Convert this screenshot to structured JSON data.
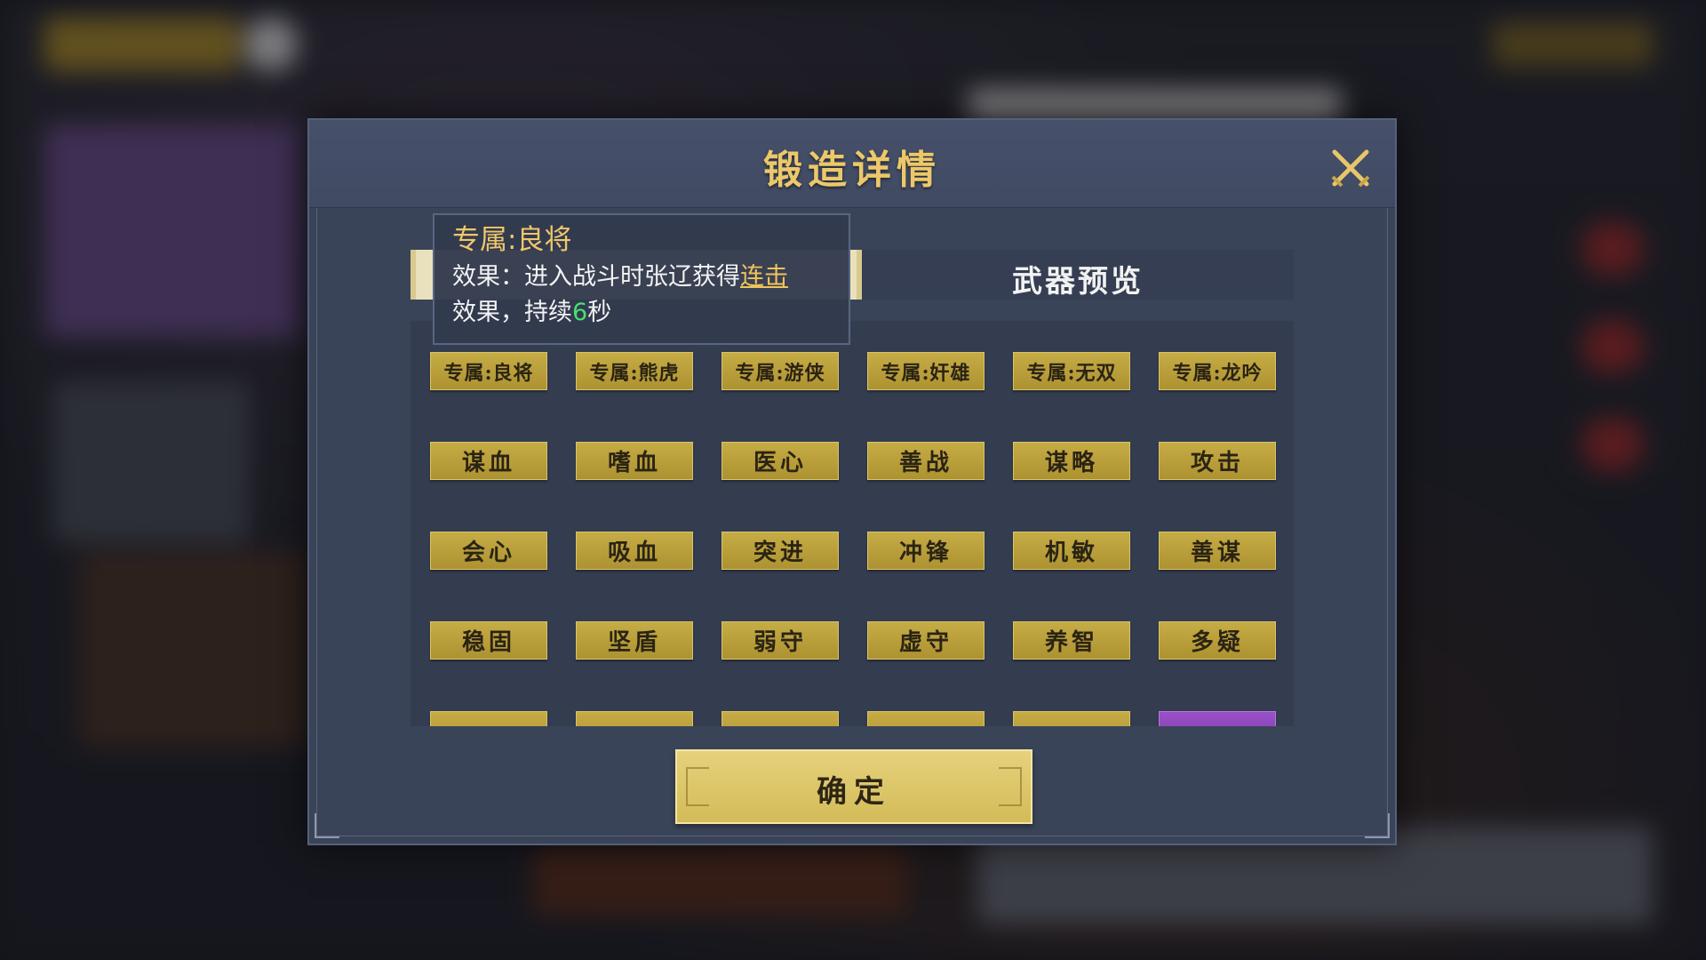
{
  "dialog": {
    "title": "锻造详情",
    "tab_preview_label": "武器预览",
    "confirm_label": "确定"
  },
  "tooltip": {
    "title": "专属:良将",
    "line1_prefix": "效果：进入战斗时张辽获得",
    "line1_link": "连击",
    "line2_prefix": "效果，持续",
    "line2_number": "6",
    "line2_suffix": "秒"
  },
  "traits": {
    "row1": [
      "专属:良将",
      "专属:熊虎",
      "专属:游侠",
      "专属:奸雄",
      "专属:无双",
      "专属:龙吟"
    ],
    "row2": [
      "谋血",
      "嗜血",
      "医心",
      "善战",
      "谋略",
      "攻击"
    ],
    "row3": [
      "会心",
      "吸血",
      "突进",
      "冲锋",
      "机敏",
      "善谋"
    ],
    "row4": [
      "稳固",
      "坚盾",
      "弱守",
      "虚守",
      "养智",
      "多疑"
    ]
  },
  "colors": {
    "trait_gold": "#c6ac45",
    "trait_purple": "#9a50c8",
    "title_gold": "#ecc86a",
    "dialog_bg": "#3a4458",
    "highlight_green": "#48e06e"
  },
  "icons": {
    "close": "crossed-swords-close-icon"
  }
}
